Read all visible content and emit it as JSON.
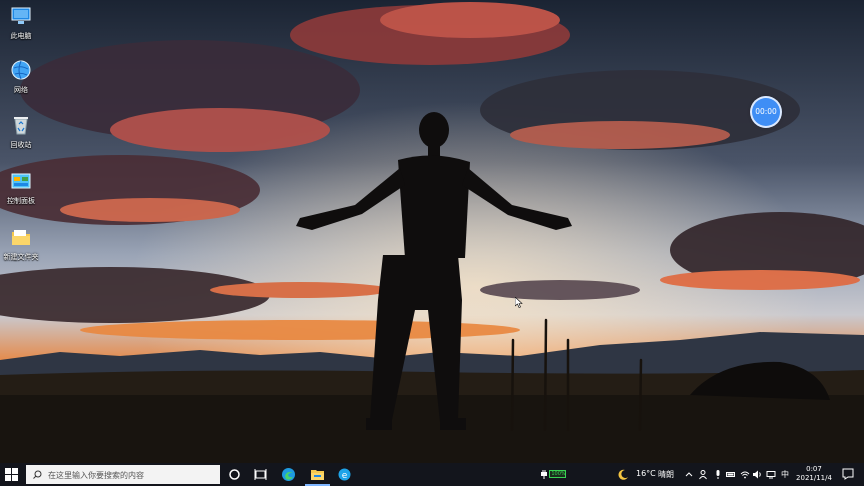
{
  "desktop": {
    "icons": [
      {
        "label": "此电脑",
        "icon": "computer-icon"
      },
      {
        "label": "网络",
        "icon": "network-globe-icon"
      },
      {
        "label": "回收站",
        "icon": "recycle-bin-icon"
      },
      {
        "label": "控制面板",
        "icon": "control-panel-icon"
      },
      {
        "label": "新建文件夹",
        "icon": "folder-icon"
      }
    ],
    "wallpaper": "man-silhouette-sunset",
    "timer_bubble": "00:00"
  },
  "taskbar": {
    "search_placeholder": "在这里输入你要搜索的内容",
    "pinned": [
      "cortana-icon",
      "task-view-icon",
      "edge-icon",
      "file-explorer-icon",
      "ie-icon"
    ],
    "battery_percent": "100%",
    "weather": {
      "temperature": "16°C",
      "description": "晴朗"
    },
    "ime": "中",
    "clock": {
      "time": "0:07",
      "date": "2021/11/4"
    }
  },
  "colors": {
    "taskbar_bg": "#13151c",
    "accent": "#3f8ef5",
    "battery_green": "#39d353"
  }
}
